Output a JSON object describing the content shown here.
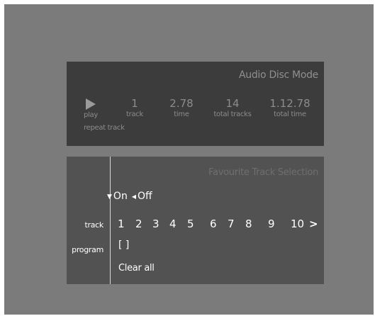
{
  "audio_panel": {
    "title": "Audio Disc Mode",
    "play_label": "play",
    "track_value": "1",
    "track_label": "track",
    "time_value": "2.78",
    "time_label": "time",
    "total_tracks_value": "14",
    "total_tracks_label": "total tracks",
    "total_time_value": "1.12.78",
    "total_time_label": "total time",
    "repeat_label": "repeat track",
    "play_icon": "play-icon"
  },
  "favourites": {
    "title": "Favourite Track Selection",
    "on_label": "On",
    "off_label": "Off",
    "track_row_label": "track",
    "program_row_label": "program",
    "tracks": [
      "1",
      "2",
      "3",
      "4",
      "5",
      "6",
      "7",
      "8",
      "9",
      "10"
    ],
    "next_arrow": ">",
    "program_value": "[ ]",
    "clear_all": "Clear all"
  }
}
